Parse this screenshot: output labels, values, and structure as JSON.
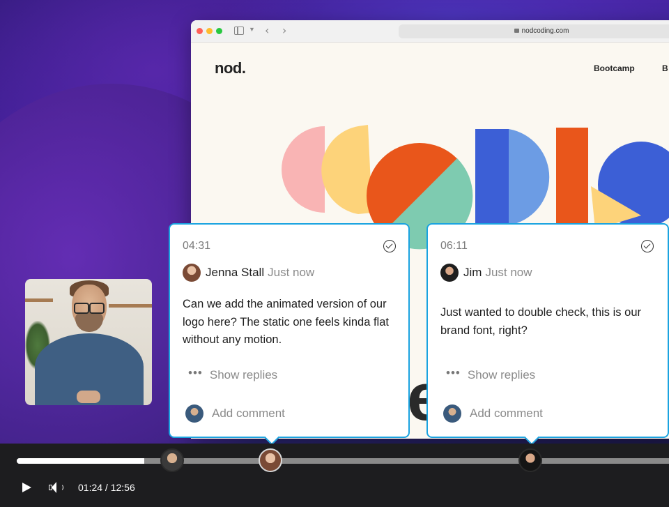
{
  "browser": {
    "url": "nodcoding.com",
    "site_logo": "nod.",
    "nav_items": [
      "Bootcamp",
      "B"
    ]
  },
  "comments": [
    {
      "timestamp": "04:31",
      "author": "Jenna Stall",
      "when": "Just now",
      "body": "Can we add the animated version of our logo here? The static one feels kinda flat without any motion.",
      "show_replies_label": "Show replies",
      "add_comment_placeholder": "Add comment"
    },
    {
      "timestamp": "06:11",
      "author": "Jim",
      "when": "Just now",
      "body": "Just wanted to double check, this is our brand font, right?",
      "show_replies_label": "Show replies",
      "add_comment_placeholder": "Add comment"
    }
  ],
  "player": {
    "current_time": "01:24",
    "duration": "12:56",
    "time_display": "01:24 / 12:56",
    "progress_fraction": 0.196
  },
  "colors": {
    "accent": "#1aa3e0",
    "background_purple": "#4b23a6",
    "control_bar": "#1d1d1f"
  },
  "icons": [
    "play-icon",
    "volume-icon",
    "resolve-check-icon",
    "more-dots-icon",
    "lock-icon",
    "sidebar-toggle-icon"
  ]
}
